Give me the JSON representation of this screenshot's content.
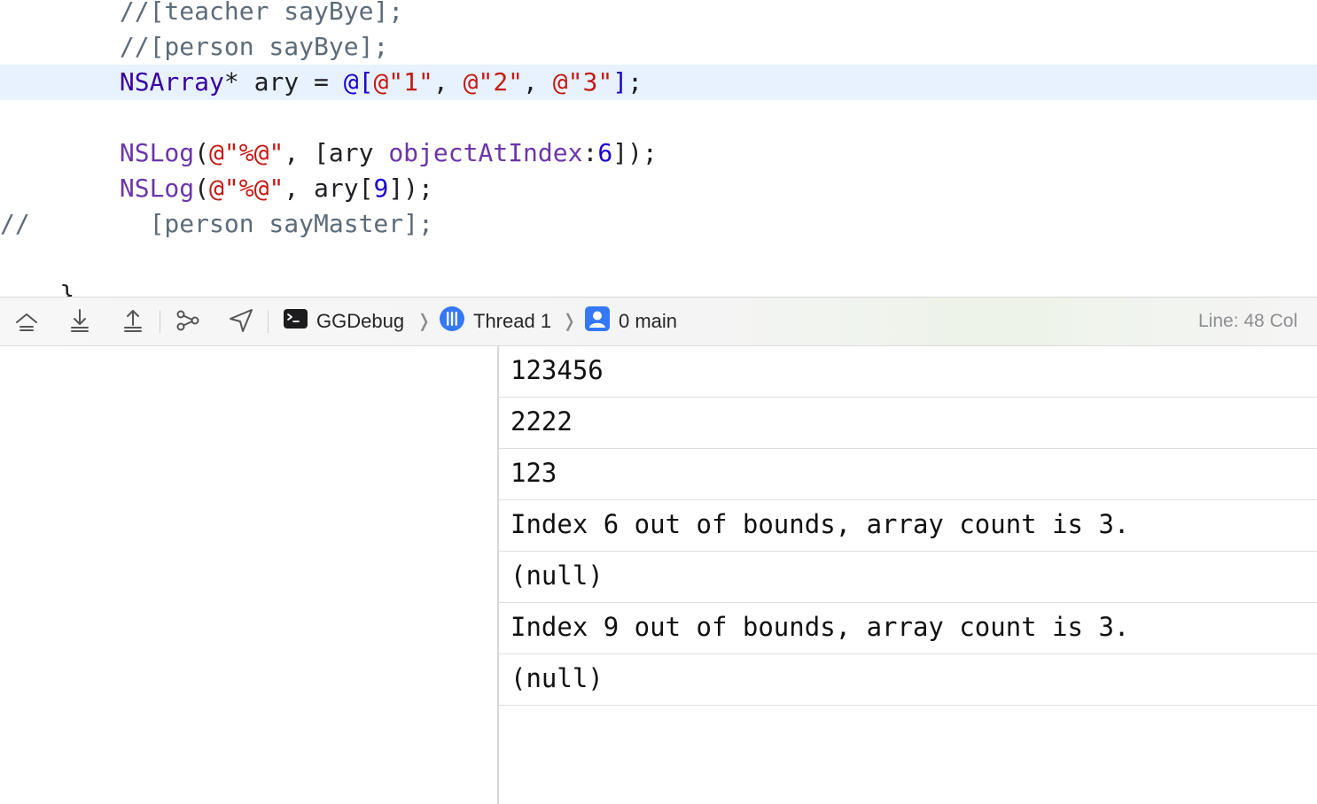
{
  "editor": {
    "lines": [
      {
        "tokens": [
          {
            "cls": "c-comment",
            "text": "        //[teacher sayBye];"
          }
        ]
      },
      {
        "tokens": [
          {
            "cls": "c-comment",
            "text": "        //[person sayBye];"
          }
        ]
      },
      {
        "highlighted": true,
        "tokens": [
          {
            "cls": "c-plain",
            "text": "        "
          },
          {
            "cls": "c-type",
            "text": "NSArray"
          },
          {
            "cls": "c-plain",
            "text": "* ary = "
          },
          {
            "cls": "c-num",
            "text": "@["
          },
          {
            "cls": "c-string",
            "text": "@\"1\""
          },
          {
            "cls": "c-plain",
            "text": ", "
          },
          {
            "cls": "c-string",
            "text": "@\"2\""
          },
          {
            "cls": "c-plain",
            "text": ", "
          },
          {
            "cls": "c-string",
            "text": "@\"3\""
          },
          {
            "cls": "c-num",
            "text": "]"
          },
          {
            "cls": "c-plain",
            "text": ";"
          }
        ]
      },
      {
        "tokens": []
      },
      {
        "tokens": [
          {
            "cls": "c-plain",
            "text": "        "
          },
          {
            "cls": "c-func",
            "text": "NSLog"
          },
          {
            "cls": "c-plain",
            "text": "("
          },
          {
            "cls": "c-string",
            "text": "@\"%@\""
          },
          {
            "cls": "c-plain",
            "text": ", [ary "
          },
          {
            "cls": "c-func",
            "text": "objectAtIndex"
          },
          {
            "cls": "c-plain",
            "text": ":"
          },
          {
            "cls": "c-num",
            "text": "6"
          },
          {
            "cls": "c-plain",
            "text": "]);"
          }
        ]
      },
      {
        "tokens": [
          {
            "cls": "c-plain",
            "text": "        "
          },
          {
            "cls": "c-func",
            "text": "NSLog"
          },
          {
            "cls": "c-plain",
            "text": "("
          },
          {
            "cls": "c-string",
            "text": "@\"%@\""
          },
          {
            "cls": "c-plain",
            "text": ", ary["
          },
          {
            "cls": "c-num",
            "text": "9"
          },
          {
            "cls": "c-plain",
            "text": "]);"
          }
        ]
      },
      {
        "tokens": [
          {
            "cls": "c-comment",
            "text": "//        [person sayMaster];"
          }
        ]
      },
      {
        "tokens": []
      },
      {
        "tokens": [
          {
            "cls": "c-plain",
            "text": "    }"
          }
        ]
      }
    ]
  },
  "debugbar": {
    "process_name": "GGDebug",
    "thread_label": "Thread 1",
    "frame_label": "0 main",
    "cursor_position": "Line: 48  Col"
  },
  "console": {
    "lines": [
      "123456",
      "2222",
      "123",
      "Index 6 out of bounds, array count is 3.",
      "(null)",
      "Index 9 out of bounds, array count is 3.",
      "(null)"
    ]
  },
  "icons": {
    "step_over": "step-over-icon",
    "step_into": "step-into-icon",
    "step_out": "step-out-icon",
    "debug_memory_graph": "memory-graph-icon",
    "simulate_location": "location-arrow-icon",
    "process": "terminal-icon",
    "thread": "thread-icon",
    "frame": "person-frame-icon"
  },
  "colors": {
    "line_highlight": "#e8f2ff",
    "keyword_type": "#3900a0",
    "function": "#6c36a9",
    "string": "#c41a16",
    "number": "#1c00cf",
    "comment": "#5d6c79",
    "thread_blue": "#3478f6"
  }
}
